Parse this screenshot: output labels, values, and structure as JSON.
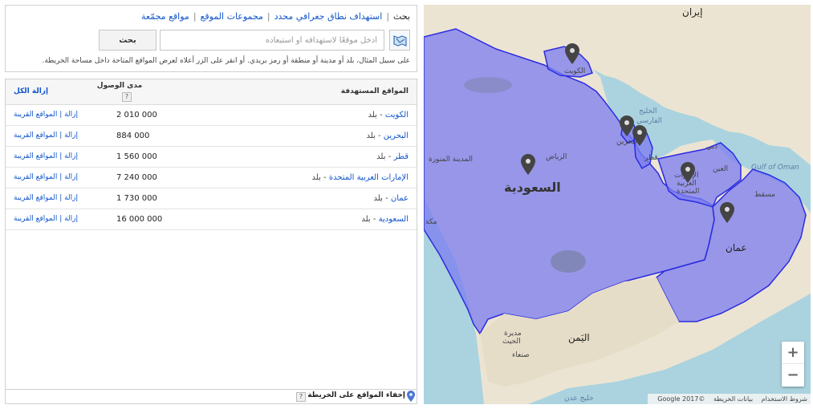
{
  "tabs": {
    "search": "بحث",
    "radius": "استهداف نطاق جغرافي محدد",
    "groups": "مجموعات الموقع",
    "bulk": "مواقع مجمّعة"
  },
  "search": {
    "placeholder": "أدخل موقعًا لاستهدافه أو استبعاده",
    "button": "بحث",
    "hint": "على سبيل المثال، بلد أو مدينة أو منطقة أو رمز بريدي. أو انقر على الزر أعلاه لعرض المواقع المتاحة داخل مساحة الخريطة."
  },
  "table": {
    "col_location": "المواقع المستهدفة",
    "col_reach": "مدى الوصول",
    "col_remove_all": "إزالة الكل",
    "help": "?",
    "type_sep": " - ",
    "rows": [
      {
        "name": "الكويت",
        "type": "بلد",
        "reach": "2 010 000",
        "actions": "إزالة | المواقع القريبة"
      },
      {
        "name": "البحرين",
        "type": "بلد",
        "reach": "884 000",
        "actions": "إزالة | المواقع القريبة"
      },
      {
        "name": "قطر",
        "type": "بلد",
        "reach": "1 560 000",
        "actions": "إزالة | المواقع القريبة"
      },
      {
        "name": "الإمارات العربية المتحدة",
        "type": "بلد",
        "reach": "7 240 000",
        "actions": "إزالة | المواقع القريبة"
      },
      {
        "name": "عمان",
        "type": "بلد",
        "reach": "1 730 000",
        "actions": "إزالة | المواقع القريبة"
      },
      {
        "name": "السعودية",
        "type": "بلد",
        "reach": "16 000 000",
        "actions": "إزالة | المواقع القريبة"
      }
    ]
  },
  "footer": {
    "hide_label": "إخفاء المواقع على الخريطة",
    "help": "?"
  },
  "map": {
    "labels": {
      "iran": "إيران",
      "kuwait": "الكويت",
      "gulf_ar": "الخليج",
      "gulf_ar2": "الفارسي",
      "bahrain": "البحرين",
      "qatar": "قطر",
      "dubai": "دبي",
      "uae1": "الإمارات",
      "uae2": "العربية",
      "uae3": "المتحدة",
      "abudhabi": "العين",
      "gulf_oman": "Gulf of Oman",
      "muscat": "مسقط",
      "riyadh": "الرياض",
      "saudi": "السعودية",
      "madinah": "المدينة المنورة",
      "makkah": "مكة",
      "oman": "عمان",
      "yemen": "اليَمن",
      "sanaa1": "مديرة",
      "sanaa2": "الحيث",
      "sanaa": "صنعاء",
      "aden": "خليج عدن"
    },
    "zoom_in": "+",
    "zoom_out": "−",
    "attribution": {
      "copyright": "©2017 Google",
      "data": "بيانات الخريطة",
      "terms": "شروط الاستخدام"
    },
    "colors": {
      "sea": "#aad3df",
      "land": "#ece4d2",
      "overlay": "#7b7cf0",
      "border": "#2c2ce0"
    }
  }
}
